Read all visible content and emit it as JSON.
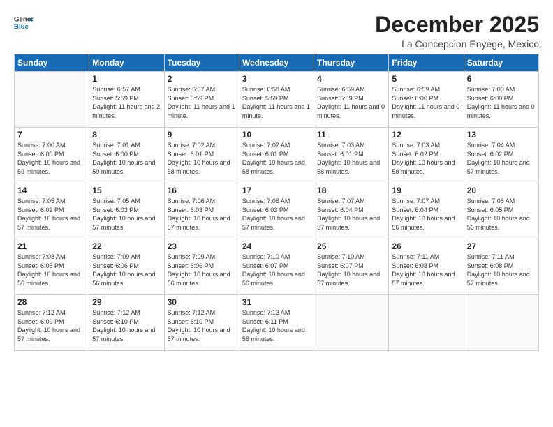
{
  "header": {
    "logo": {
      "general": "General",
      "blue": "Blue"
    },
    "title": "December 2025",
    "location": "La Concepcion Enyege, Mexico"
  },
  "days_of_week": [
    "Sunday",
    "Monday",
    "Tuesday",
    "Wednesday",
    "Thursday",
    "Friday",
    "Saturday"
  ],
  "weeks": [
    [
      {
        "day": "",
        "sunrise": "",
        "sunset": "",
        "daylight": ""
      },
      {
        "day": "1",
        "sunrise": "6:57 AM",
        "sunset": "5:59 PM",
        "daylight": "11 hours and 2 minutes."
      },
      {
        "day": "2",
        "sunrise": "6:57 AM",
        "sunset": "5:59 PM",
        "daylight": "11 hours and 1 minute."
      },
      {
        "day": "3",
        "sunrise": "6:58 AM",
        "sunset": "5:59 PM",
        "daylight": "11 hours and 1 minute."
      },
      {
        "day": "4",
        "sunrise": "6:59 AM",
        "sunset": "5:59 PM",
        "daylight": "11 hours and 0 minutes."
      },
      {
        "day": "5",
        "sunrise": "6:59 AM",
        "sunset": "6:00 PM",
        "daylight": "11 hours and 0 minutes."
      },
      {
        "day": "6",
        "sunrise": "7:00 AM",
        "sunset": "6:00 PM",
        "daylight": "11 hours and 0 minutes."
      }
    ],
    [
      {
        "day": "7",
        "sunrise": "7:00 AM",
        "sunset": "6:00 PM",
        "daylight": "10 hours and 59 minutes."
      },
      {
        "day": "8",
        "sunrise": "7:01 AM",
        "sunset": "6:00 PM",
        "daylight": "10 hours and 59 minutes."
      },
      {
        "day": "9",
        "sunrise": "7:02 AM",
        "sunset": "6:01 PM",
        "daylight": "10 hours and 58 minutes."
      },
      {
        "day": "10",
        "sunrise": "7:02 AM",
        "sunset": "6:01 PM",
        "daylight": "10 hours and 58 minutes."
      },
      {
        "day": "11",
        "sunrise": "7:03 AM",
        "sunset": "6:01 PM",
        "daylight": "10 hours and 58 minutes."
      },
      {
        "day": "12",
        "sunrise": "7:03 AM",
        "sunset": "6:02 PM",
        "daylight": "10 hours and 58 minutes."
      },
      {
        "day": "13",
        "sunrise": "7:04 AM",
        "sunset": "6:02 PM",
        "daylight": "10 hours and 57 minutes."
      }
    ],
    [
      {
        "day": "14",
        "sunrise": "7:05 AM",
        "sunset": "6:02 PM",
        "daylight": "10 hours and 57 minutes."
      },
      {
        "day": "15",
        "sunrise": "7:05 AM",
        "sunset": "6:03 PM",
        "daylight": "10 hours and 57 minutes."
      },
      {
        "day": "16",
        "sunrise": "7:06 AM",
        "sunset": "6:03 PM",
        "daylight": "10 hours and 57 minutes."
      },
      {
        "day": "17",
        "sunrise": "7:06 AM",
        "sunset": "6:03 PM",
        "daylight": "10 hours and 57 minutes."
      },
      {
        "day": "18",
        "sunrise": "7:07 AM",
        "sunset": "6:04 PM",
        "daylight": "10 hours and 57 minutes."
      },
      {
        "day": "19",
        "sunrise": "7:07 AM",
        "sunset": "6:04 PM",
        "daylight": "10 hours and 56 minutes."
      },
      {
        "day": "20",
        "sunrise": "7:08 AM",
        "sunset": "6:05 PM",
        "daylight": "10 hours and 56 minutes."
      }
    ],
    [
      {
        "day": "21",
        "sunrise": "7:08 AM",
        "sunset": "6:05 PM",
        "daylight": "10 hours and 56 minutes."
      },
      {
        "day": "22",
        "sunrise": "7:09 AM",
        "sunset": "6:06 PM",
        "daylight": "10 hours and 56 minutes."
      },
      {
        "day": "23",
        "sunrise": "7:09 AM",
        "sunset": "6:06 PM",
        "daylight": "10 hours and 56 minutes."
      },
      {
        "day": "24",
        "sunrise": "7:10 AM",
        "sunset": "6:07 PM",
        "daylight": "10 hours and 56 minutes."
      },
      {
        "day": "25",
        "sunrise": "7:10 AM",
        "sunset": "6:07 PM",
        "daylight": "10 hours and 57 minutes."
      },
      {
        "day": "26",
        "sunrise": "7:11 AM",
        "sunset": "6:08 PM",
        "daylight": "10 hours and 57 minutes."
      },
      {
        "day": "27",
        "sunrise": "7:11 AM",
        "sunset": "6:08 PM",
        "daylight": "10 hours and 57 minutes."
      }
    ],
    [
      {
        "day": "28",
        "sunrise": "7:12 AM",
        "sunset": "6:09 PM",
        "daylight": "10 hours and 57 minutes."
      },
      {
        "day": "29",
        "sunrise": "7:12 AM",
        "sunset": "6:10 PM",
        "daylight": "10 hours and 57 minutes."
      },
      {
        "day": "30",
        "sunrise": "7:12 AM",
        "sunset": "6:10 PM",
        "daylight": "10 hours and 57 minutes."
      },
      {
        "day": "31",
        "sunrise": "7:13 AM",
        "sunset": "6:11 PM",
        "daylight": "10 hours and 58 minutes."
      },
      {
        "day": "",
        "sunrise": "",
        "sunset": "",
        "daylight": ""
      },
      {
        "day": "",
        "sunrise": "",
        "sunset": "",
        "daylight": ""
      },
      {
        "day": "",
        "sunrise": "",
        "sunset": "",
        "daylight": ""
      }
    ]
  ]
}
